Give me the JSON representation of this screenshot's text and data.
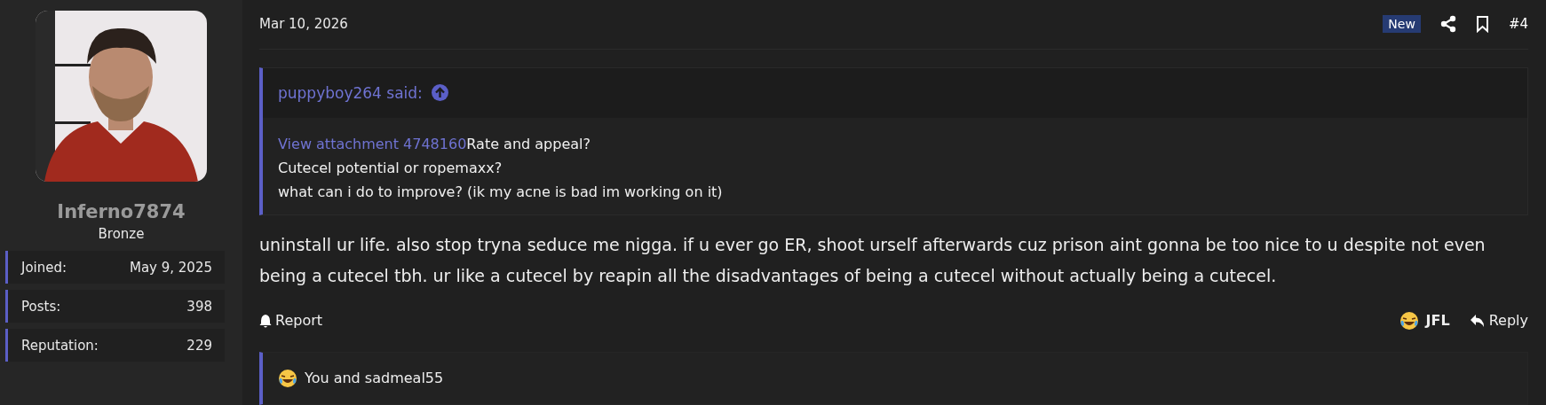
{
  "author": {
    "username": "Inferno7874",
    "rank": "Bronze",
    "stats": [
      {
        "label": "Joined:",
        "value": "May 9, 2025"
      },
      {
        "label": "Posts:",
        "value": "398"
      },
      {
        "label": "Reputation:",
        "value": "229"
      }
    ]
  },
  "post": {
    "date": "Mar 10, 2026",
    "badge": "New",
    "number": "#4",
    "quote": {
      "author": "puppyboy264 said:",
      "attachment_link": "View attachment 4748160",
      "lines": [
        "Rate and appeal?",
        "Cutecel potential or ropemaxx?",
        "what can i do to improve? (ik my acne is bad im working on it)"
      ]
    },
    "message": "uninstall ur life. also stop tryna seduce me nigga. if u ever go ER, shoot urself afterwards cuz prison aint gonna be too nice to u despite not even being a cutecel tbh. ur like a cutecel by reapin all the disadvantages of being a cutecel without actually being a cutecel.",
    "actions": {
      "report": "Report",
      "reaction": "JFL",
      "reply": "Reply"
    },
    "reactions_summary": "You and sadmeal55"
  }
}
